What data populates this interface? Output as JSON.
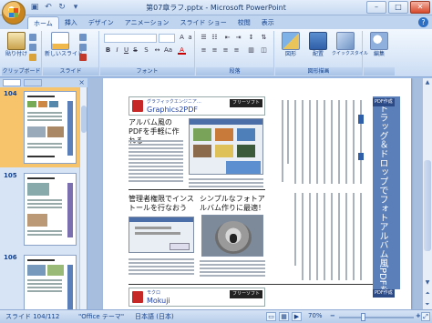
{
  "window": {
    "title": "第07章ラフ.pptx - Microsoft PowerPoint",
    "controls": [
      "–",
      "□",
      "✕"
    ]
  },
  "quick_access": [
    "save-icon",
    "undo-icon",
    "redo-icon",
    "dropdown-icon"
  ],
  "tabs": [
    {
      "label": "ホーム",
      "active": true
    },
    {
      "label": "挿入",
      "active": false
    },
    {
      "label": "デザイン",
      "active": false
    },
    {
      "label": "アニメーション",
      "active": false
    },
    {
      "label": "スライド ショー",
      "active": false
    },
    {
      "label": "校閲",
      "active": false
    },
    {
      "label": "表示",
      "active": false
    }
  ],
  "ribbon": {
    "groups": [
      {
        "name": "クリップボード",
        "buttons": [
          "貼り付け"
        ]
      },
      {
        "name": "スライド",
        "buttons": [
          "新しいスライド"
        ]
      },
      {
        "name": "フォント"
      },
      {
        "name": "段落"
      },
      {
        "name": "図形描画",
        "buttons": [
          "図形",
          "配置",
          "クイックスタイル"
        ]
      },
      {
        "name": "",
        "buttons": [
          "編集"
        ]
      }
    ],
    "paste_label": "貼り付け",
    "new_slide_label": "新しいスライド",
    "shapes_label": "図形",
    "arrange_label": "配置",
    "quick_style_label": "クイックスタイル",
    "edit_label": "編集"
  },
  "slides_pane": {
    "close": "×",
    "thumbnails": [
      {
        "number": "104",
        "selected": true
      },
      {
        "number": "105",
        "selected": false
      },
      {
        "number": "106",
        "selected": false
      }
    ]
  },
  "slide": {
    "top_section": {
      "small_title": "グラフィックエンジニア…",
      "big_title": "Graphics2PDF",
      "tag": "フリーソフト",
      "heading": "アルバム風のPDFを手軽に作れる"
    },
    "mid_left": {
      "heading": "管理者権限でインストールを行なおう"
    },
    "mid_right": {
      "heading": "シンプルなフォトアルバム作りに最適！"
    },
    "vertical_title": "ドラッグ＆ドロップでフォトアルバム風PDFを作れる",
    "caption_tag": "PDF作成",
    "bottom_section": {
      "small_title": "モクロ",
      "big_title": "Mokuji",
      "tag": "フリーソフト"
    }
  },
  "status_bar": {
    "slide_info": "スライド 104/112",
    "theme": "\"Office テーマ\"",
    "language": "日本語 (日本)",
    "zoom": "70%",
    "zoom_level_percent": 70
  },
  "colors": {
    "accent_blue": "#5b7fb8",
    "selected_thumb": "#f7c46b",
    "ribbon_bg": "#dbe8f8"
  }
}
